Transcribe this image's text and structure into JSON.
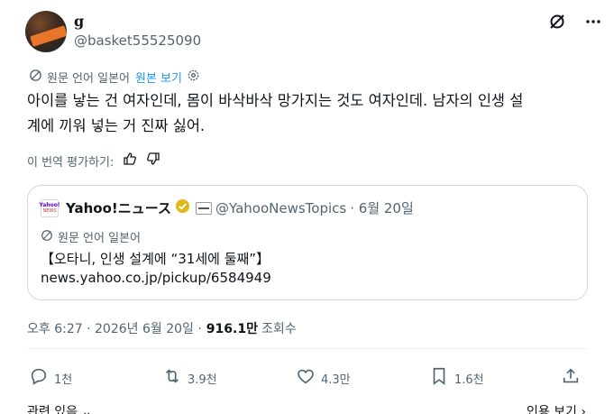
{
  "author": {
    "name": "g",
    "handle": "@basket55525090"
  },
  "translation": {
    "label": "원문 언어 일본어",
    "show_original": "원본 보기"
  },
  "tweet": {
    "line1": "아이를 낳는 건 여자인데, 몸이 바삭바삭 망가지는 것도 여자인데. 남자의 인생 설",
    "line2": "계에 끼워 넣는 거 진짜 싫어."
  },
  "rate": {
    "label": "이 번역 평가하기:"
  },
  "quote": {
    "name": "Yahoo!ニュース",
    "handle": "@YahooNewsTopics",
    "date": "· 6월 20일",
    "logo_top": "Yahoo!",
    "logo_bottom": "NEWS",
    "translation_label": "원문 언어 일본어",
    "text_line1": "【오타니, 인생 설계에 “31세에 둘째”】",
    "text_line2": "news.yahoo.co.jp/pickup/6584949"
  },
  "meta": {
    "time": "오후 6:27 · 2026년 6월 20일 ·",
    "views": "916.1만",
    "views_label": "조회수"
  },
  "actions": {
    "reply": "1천",
    "retweet": "3.9천",
    "like": "4.3만",
    "bookmark": "1.6천"
  },
  "bottom": {
    "related": "관련 있음 ⌄",
    "quotes": "인용 보기 ›"
  },
  "colors": {
    "link": "#1d9bf0",
    "muted": "#536471",
    "text": "#0f1419",
    "border": "#cfd9de",
    "verified_gold": "#e2b719"
  },
  "icons": [
    "grok-icon",
    "more-icon",
    "globe-icon",
    "gear-icon",
    "thumbs-up-icon",
    "thumbs-down-icon",
    "verified-gold-icon",
    "reply-icon",
    "retweet-icon",
    "like-icon",
    "bookmark-icon",
    "share-icon"
  ]
}
